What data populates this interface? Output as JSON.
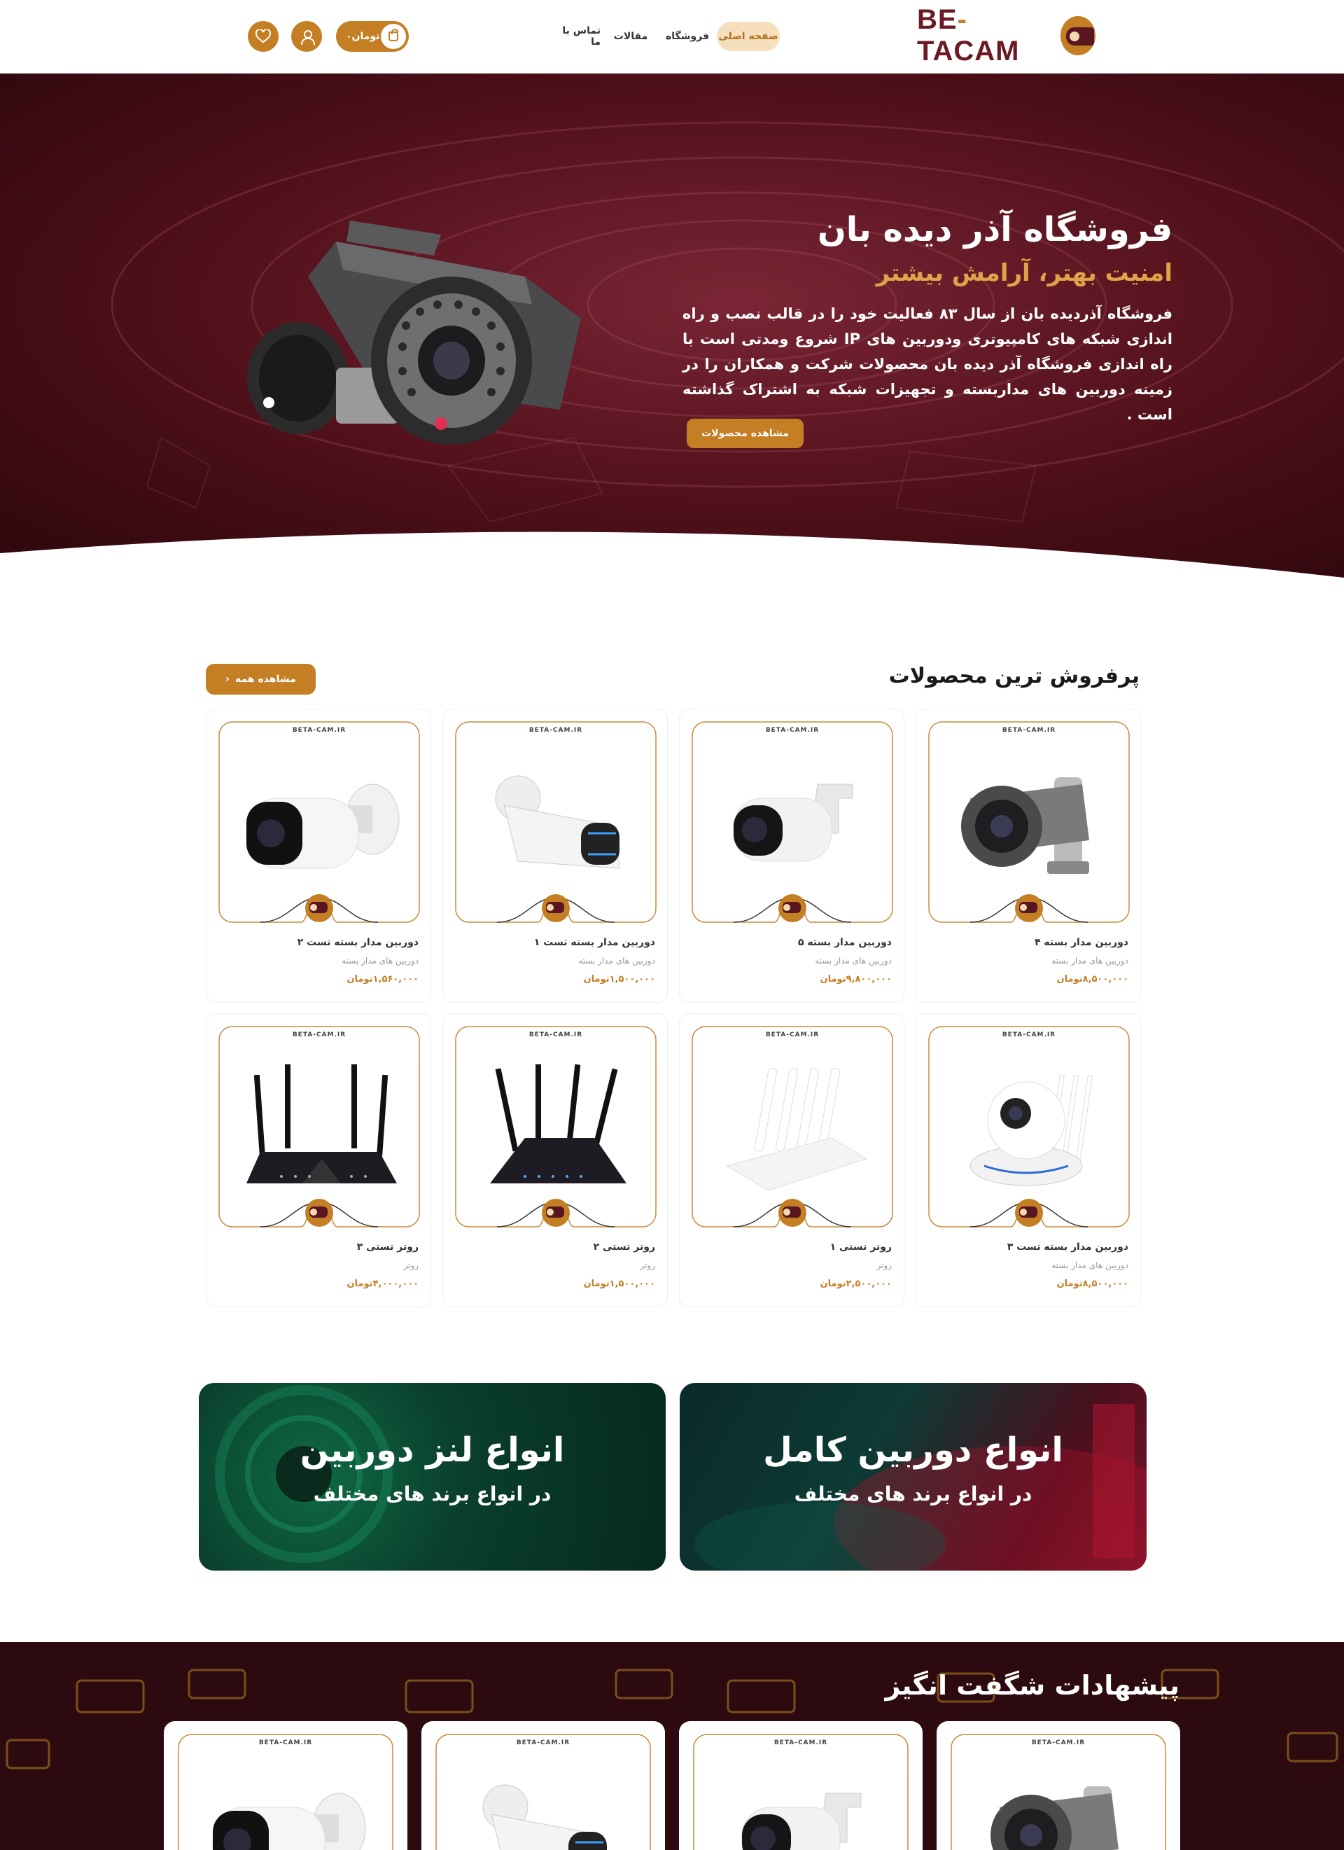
{
  "header": {
    "logo_text_left": "BE",
    "logo_text_right": "TACAM",
    "nav": {
      "home": "صفحه اصلی",
      "shop": "فروشگاه",
      "articles": "مقالات",
      "contact": "تماس با ما"
    },
    "cart_label": "تومان۰",
    "cart_count": "0"
  },
  "hero": {
    "title": "فروشگاه آذر دیده بان",
    "subtitle": "امنیت بهتر، آرامش بیشتر",
    "description": "فروشگاه آذردیده بان از سال ۸۳ فعالیت خود را در قالب نصب و راه اندازی شبکه های کامپیوتری ودوربین های IP شروع ومدتی است با راه اندازی فروشگاه آذر دیده بان محصولات شرکت و همکاران را در زمینه دوربین های مداربسته و تجهیزات شبکه به اشتراک گذاشته است .",
    "button": "مشاهده محصولات"
  },
  "bestsellers": {
    "title": "پرفروش ترین محصولات",
    "see_all": "مشاهده همه",
    "brand_mark": "BETA-CAM.IR",
    "products": [
      {
        "name": "دوربین مدار بسته ۴",
        "category": "دوربین های مدار بسته",
        "price": "۸,۵۰۰,۰۰۰تومان"
      },
      {
        "name": "دوربین مدار بسته ۵",
        "category": "دوربین های مدار بسته",
        "price": "۹,۸۰۰,۰۰۰تومان"
      },
      {
        "name": "دوربین مدار بسته تست ۱",
        "category": "دوربین های مدار بسته",
        "price": "۱,۵۰۰,۰۰۰تومان"
      },
      {
        "name": "دوربین مدار بسته تست ۲",
        "category": "دوربین های مدار بسته",
        "price": "۱,۵۶۰,۰۰۰تومان"
      },
      {
        "name": "دوربین مدار بسته تست ۳",
        "category": "دوربین های مدار بسته",
        "price": "۸,۵۰۰,۰۰۰تومان"
      },
      {
        "name": "روتر تستی ۱",
        "category": "روتر",
        "price": "۲,۵۰۰,۰۰۰تومان"
      },
      {
        "name": "روتر تستی ۲",
        "category": "روتر",
        "price": "۱,۵۰۰,۰۰۰تومان"
      },
      {
        "name": "روتر تستی ۳",
        "category": "روتر",
        "price": "۴,۰۰۰,۰۰۰تومان"
      }
    ]
  },
  "banners": {
    "camera": {
      "title": "انواع دوربین کامل",
      "subtitle": "در انواع برند های مختلف"
    },
    "lens": {
      "title": "انواع لنز دوربین",
      "subtitle": "در انواع برند های مختلف"
    }
  },
  "offers": {
    "title": "پیشهادات شگفت انگیز"
  },
  "colors": {
    "accent": "#c47f25",
    "hero_bg": "#4a0d18",
    "dark": "#2d0a10",
    "green": "#073b2a"
  }
}
